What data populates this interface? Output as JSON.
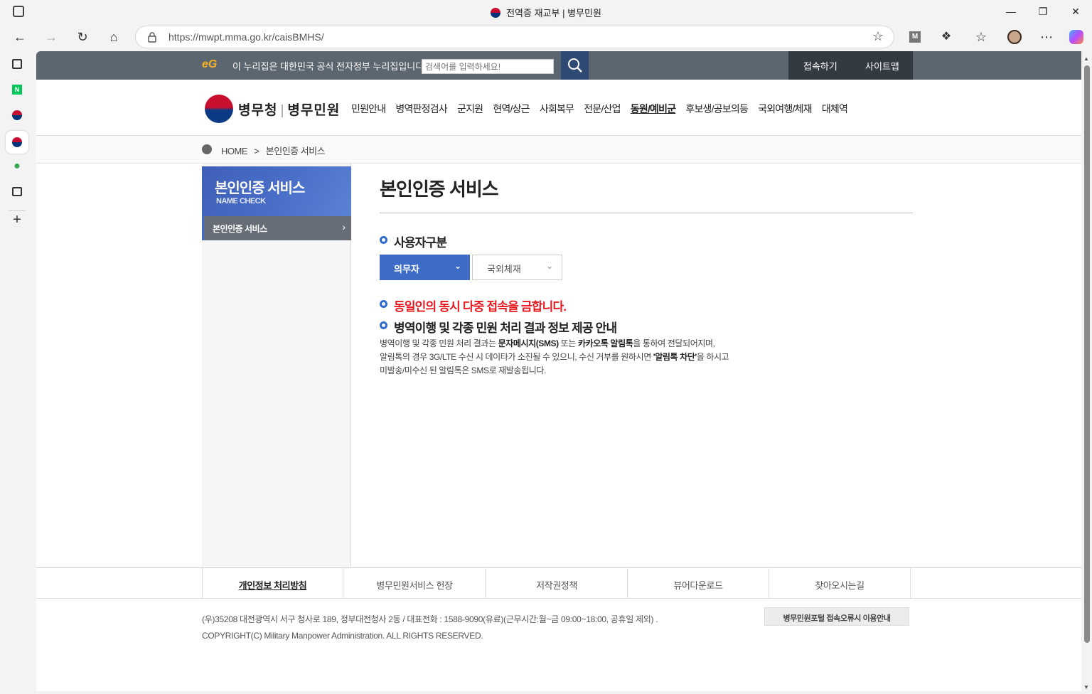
{
  "window": {
    "title": "전역증 재교부 | 병무민원"
  },
  "browser": {
    "url": "https://mwpt.mma.go.kr/caisBMHS/"
  },
  "govbar": {
    "logo_text": "eG",
    "notice": "이 누리집은 대한민국 공식 전자정부 누리집입니다.",
    "search_placeholder": "검색어를 입력하세요!",
    "links": [
      "접속하기",
      "사이트맵"
    ]
  },
  "header": {
    "logo_org": "병무청",
    "logo_sub": "병무민원",
    "menu": [
      "민원안내",
      "병역판정검사",
      "군지원",
      "현역/상근",
      "사회복무",
      "전문/산업",
      "동원/예비군",
      "후보생/공보의등",
      "국외여행/체재",
      "대체역"
    ],
    "active_menu": "동원/예비군"
  },
  "breadcrumb": {
    "home": "HOME",
    "sep": ">",
    "current": "본인인증 서비스"
  },
  "lnb": {
    "title": "본인인증 서비스",
    "subtitle": "NAME CHECK",
    "items": [
      {
        "label": "본인인증 서비스",
        "arrow": "›"
      }
    ]
  },
  "content": {
    "title": "본인인증 서비스",
    "user_type_heading": "사용자구분",
    "select_primary": "의무자",
    "select_secondary": "국외체재",
    "warning": "동일인의 동시 다중 접속을 금합니다.",
    "info_heading": "병역이행 및 각종 민원 처리 결과 정보 제공 안내",
    "desc_line1_a": "병역이행 및 각종 민원 처리 결과는 ",
    "desc_line1_b": "문자메시지(SMS)",
    "desc_line1_c": " 또는 ",
    "desc_line1_d": "카카오톡 알림톡",
    "desc_line1_e": "을 통하여 전달되어지며,",
    "desc_line2_a": "알림톡의 경우 3G/LTE 수신 시 데이타가 소진될 수 있으니, 수신 거부를 원하시면 ",
    "desc_line2_b": "'알림톡 차단'",
    "desc_line2_c": "을 하시고",
    "desc_line3": "미발송/미수신 된 알림톡은 SMS로 재발송됩니다."
  },
  "footer": {
    "links": [
      "개인정보 처리방침",
      "병무민원서비스 헌장",
      "저작권정책",
      "뷰어다운로드",
      "찾아오시는길"
    ],
    "address": "(우)35208 대전광역시 서구 청사로 189, 정부대전청사 2동 / 대표전화 : 1588-9090(유료)(근무시간:월~금 09:00~18:00, 공휴일 제외) .",
    "copyright": "COPYRIGHT(C) Military Manpower Administration. ALL RIGHTS RESERVED.",
    "error_button": "병무민원포털 접속오류시 이용안내"
  },
  "colors": {
    "govbar": "#5c6670",
    "accent": "#3d6bc6",
    "warning": "#e8171f"
  }
}
